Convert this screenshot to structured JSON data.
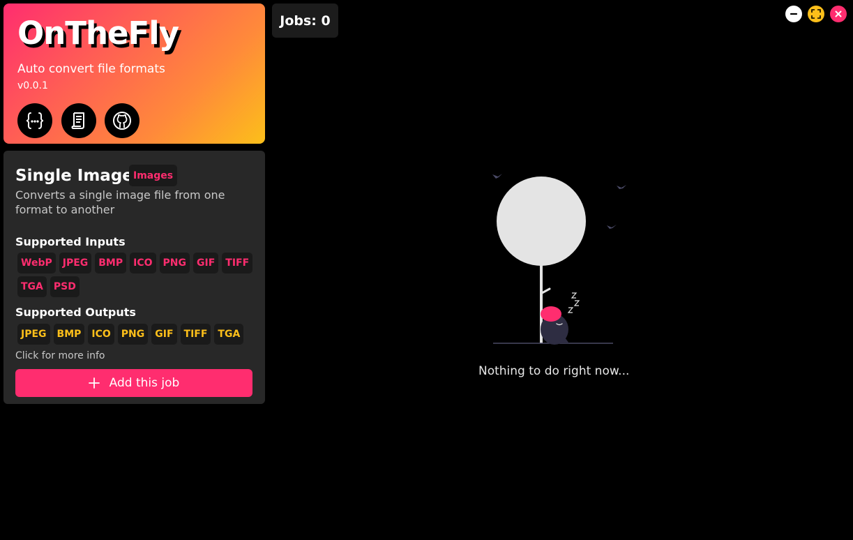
{
  "header": {
    "title": "OnTheFly",
    "tagline": "Auto convert file formats",
    "version": "v0.0.1",
    "buttons": [
      {
        "icon": "braces-icon"
      },
      {
        "icon": "document-icon"
      },
      {
        "icon": "github-icon"
      }
    ],
    "gradient": [
      "#ff2d6f",
      "#fcbf1a"
    ]
  },
  "jobs": {
    "label": "Jobs: 0"
  },
  "window_controls": [
    {
      "icon": "minimize-icon",
      "color": "#ffffff"
    },
    {
      "icon": "maximize-icon",
      "color": "#fcbf1a"
    },
    {
      "icon": "close-icon",
      "color": "#ff2d6f"
    }
  ],
  "job_card": {
    "title": "Single Image",
    "category": "Images",
    "description": "Converts a single image file from one format to another",
    "inputs_heading": "Supported Inputs",
    "inputs": [
      "WebP",
      "JPEG",
      "BMP",
      "ICO",
      "PNG",
      "GIF",
      "TIFF",
      "TGA",
      "PSD"
    ],
    "outputs_heading": "Supported Outputs",
    "outputs": [
      "JPEG",
      "BMP",
      "ICO",
      "PNG",
      "GIF",
      "TIFF",
      "TGA"
    ],
    "more_info": "Click for more info",
    "add_label": "Add this job"
  },
  "empty_state": {
    "message": "Nothing to do right now...",
    "illustration": "sleeping-under-tree"
  },
  "colors": {
    "accent": "#ff2d6f",
    "secondary": "#fcbf1a",
    "card_bg": "#282828",
    "tag_bg": "#1a1a1a"
  }
}
